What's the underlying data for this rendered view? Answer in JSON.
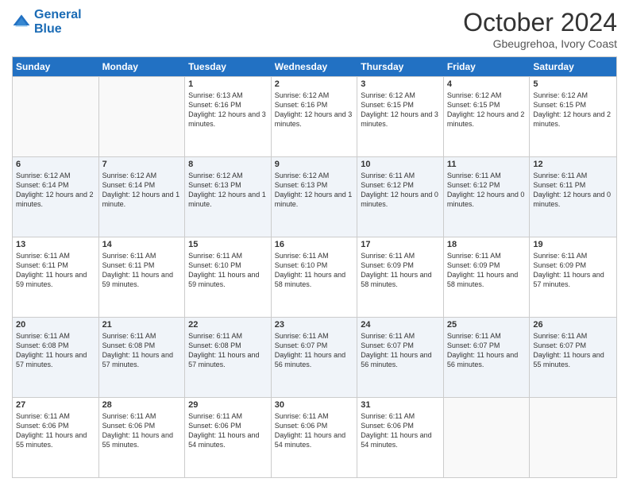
{
  "logo": {
    "line1": "General",
    "line2": "Blue"
  },
  "title": "October 2024",
  "location": "Gbeugrehoa, Ivory Coast",
  "days": [
    "Sunday",
    "Monday",
    "Tuesday",
    "Wednesday",
    "Thursday",
    "Friday",
    "Saturday"
  ],
  "weeks": [
    [
      {
        "date": "",
        "sunrise": "",
        "sunset": "",
        "daylight": ""
      },
      {
        "date": "",
        "sunrise": "",
        "sunset": "",
        "daylight": ""
      },
      {
        "date": "1",
        "sunrise": "Sunrise: 6:13 AM",
        "sunset": "Sunset: 6:16 PM",
        "daylight": "Daylight: 12 hours and 3 minutes."
      },
      {
        "date": "2",
        "sunrise": "Sunrise: 6:12 AM",
        "sunset": "Sunset: 6:16 PM",
        "daylight": "Daylight: 12 hours and 3 minutes."
      },
      {
        "date": "3",
        "sunrise": "Sunrise: 6:12 AM",
        "sunset": "Sunset: 6:15 PM",
        "daylight": "Daylight: 12 hours and 3 minutes."
      },
      {
        "date": "4",
        "sunrise": "Sunrise: 6:12 AM",
        "sunset": "Sunset: 6:15 PM",
        "daylight": "Daylight: 12 hours and 2 minutes."
      },
      {
        "date": "5",
        "sunrise": "Sunrise: 6:12 AM",
        "sunset": "Sunset: 6:15 PM",
        "daylight": "Daylight: 12 hours and 2 minutes."
      }
    ],
    [
      {
        "date": "6",
        "sunrise": "Sunrise: 6:12 AM",
        "sunset": "Sunset: 6:14 PM",
        "daylight": "Daylight: 12 hours and 2 minutes."
      },
      {
        "date": "7",
        "sunrise": "Sunrise: 6:12 AM",
        "sunset": "Sunset: 6:14 PM",
        "daylight": "Daylight: 12 hours and 1 minute."
      },
      {
        "date": "8",
        "sunrise": "Sunrise: 6:12 AM",
        "sunset": "Sunset: 6:13 PM",
        "daylight": "Daylight: 12 hours and 1 minute."
      },
      {
        "date": "9",
        "sunrise": "Sunrise: 6:12 AM",
        "sunset": "Sunset: 6:13 PM",
        "daylight": "Daylight: 12 hours and 1 minute."
      },
      {
        "date": "10",
        "sunrise": "Sunrise: 6:11 AM",
        "sunset": "Sunset: 6:12 PM",
        "daylight": "Daylight: 12 hours and 0 minutes."
      },
      {
        "date": "11",
        "sunrise": "Sunrise: 6:11 AM",
        "sunset": "Sunset: 6:12 PM",
        "daylight": "Daylight: 12 hours and 0 minutes."
      },
      {
        "date": "12",
        "sunrise": "Sunrise: 6:11 AM",
        "sunset": "Sunset: 6:11 PM",
        "daylight": "Daylight: 12 hours and 0 minutes."
      }
    ],
    [
      {
        "date": "13",
        "sunrise": "Sunrise: 6:11 AM",
        "sunset": "Sunset: 6:11 PM",
        "daylight": "Daylight: 11 hours and 59 minutes."
      },
      {
        "date": "14",
        "sunrise": "Sunrise: 6:11 AM",
        "sunset": "Sunset: 6:11 PM",
        "daylight": "Daylight: 11 hours and 59 minutes."
      },
      {
        "date": "15",
        "sunrise": "Sunrise: 6:11 AM",
        "sunset": "Sunset: 6:10 PM",
        "daylight": "Daylight: 11 hours and 59 minutes."
      },
      {
        "date": "16",
        "sunrise": "Sunrise: 6:11 AM",
        "sunset": "Sunset: 6:10 PM",
        "daylight": "Daylight: 11 hours and 58 minutes."
      },
      {
        "date": "17",
        "sunrise": "Sunrise: 6:11 AM",
        "sunset": "Sunset: 6:09 PM",
        "daylight": "Daylight: 11 hours and 58 minutes."
      },
      {
        "date": "18",
        "sunrise": "Sunrise: 6:11 AM",
        "sunset": "Sunset: 6:09 PM",
        "daylight": "Daylight: 11 hours and 58 minutes."
      },
      {
        "date": "19",
        "sunrise": "Sunrise: 6:11 AM",
        "sunset": "Sunset: 6:09 PM",
        "daylight": "Daylight: 11 hours and 57 minutes."
      }
    ],
    [
      {
        "date": "20",
        "sunrise": "Sunrise: 6:11 AM",
        "sunset": "Sunset: 6:08 PM",
        "daylight": "Daylight: 11 hours and 57 minutes."
      },
      {
        "date": "21",
        "sunrise": "Sunrise: 6:11 AM",
        "sunset": "Sunset: 6:08 PM",
        "daylight": "Daylight: 11 hours and 57 minutes."
      },
      {
        "date": "22",
        "sunrise": "Sunrise: 6:11 AM",
        "sunset": "Sunset: 6:08 PM",
        "daylight": "Daylight: 11 hours and 57 minutes."
      },
      {
        "date": "23",
        "sunrise": "Sunrise: 6:11 AM",
        "sunset": "Sunset: 6:07 PM",
        "daylight": "Daylight: 11 hours and 56 minutes."
      },
      {
        "date": "24",
        "sunrise": "Sunrise: 6:11 AM",
        "sunset": "Sunset: 6:07 PM",
        "daylight": "Daylight: 11 hours and 56 minutes."
      },
      {
        "date": "25",
        "sunrise": "Sunrise: 6:11 AM",
        "sunset": "Sunset: 6:07 PM",
        "daylight": "Daylight: 11 hours and 56 minutes."
      },
      {
        "date": "26",
        "sunrise": "Sunrise: 6:11 AM",
        "sunset": "Sunset: 6:07 PM",
        "daylight": "Daylight: 11 hours and 55 minutes."
      }
    ],
    [
      {
        "date": "27",
        "sunrise": "Sunrise: 6:11 AM",
        "sunset": "Sunset: 6:06 PM",
        "daylight": "Daylight: 11 hours and 55 minutes."
      },
      {
        "date": "28",
        "sunrise": "Sunrise: 6:11 AM",
        "sunset": "Sunset: 6:06 PM",
        "daylight": "Daylight: 11 hours and 55 minutes."
      },
      {
        "date": "29",
        "sunrise": "Sunrise: 6:11 AM",
        "sunset": "Sunset: 6:06 PM",
        "daylight": "Daylight: 11 hours and 54 minutes."
      },
      {
        "date": "30",
        "sunrise": "Sunrise: 6:11 AM",
        "sunset": "Sunset: 6:06 PM",
        "daylight": "Daylight: 11 hours and 54 minutes."
      },
      {
        "date": "31",
        "sunrise": "Sunrise: 6:11 AM",
        "sunset": "Sunset: 6:06 PM",
        "daylight": "Daylight: 11 hours and 54 minutes."
      },
      {
        "date": "",
        "sunrise": "",
        "sunset": "",
        "daylight": ""
      },
      {
        "date": "",
        "sunrise": "",
        "sunset": "",
        "daylight": ""
      }
    ]
  ]
}
